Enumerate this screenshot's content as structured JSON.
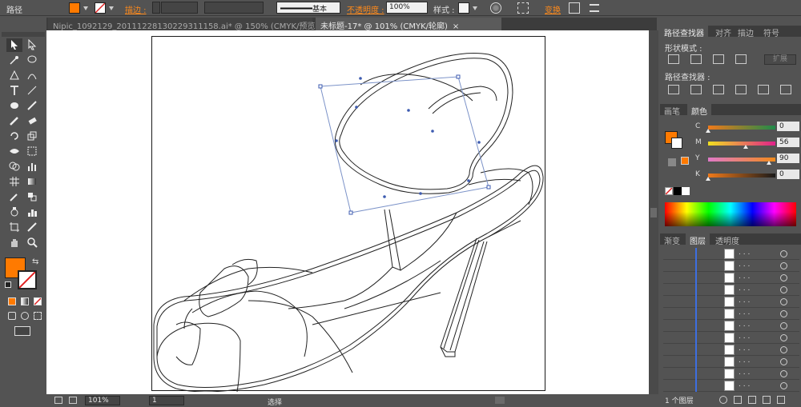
{
  "control_bar": {
    "object_type": "路径",
    "fill_color": "#ff7a00",
    "stroke_label": "描边 :",
    "stroke_profile_label": "基本",
    "opacity_label": "不透明度 :",
    "opacity_value": "100%",
    "style_label": "样式 :",
    "transform_label": "变换"
  },
  "tabs": [
    {
      "label": "Nipic_1092129_20111228130229311158.ai* @ 150% (CMYK/预览)",
      "close": "×"
    },
    {
      "label": "未标题-17* @ 101% (CMYK/轮廓)",
      "close": "×"
    }
  ],
  "tools": {
    "fill_color": "#ff7a00",
    "stroke_color": "#ffffff"
  },
  "status_bar": {
    "zoom": "101%",
    "page": "1",
    "mode": "选择"
  },
  "pathfinder_panel": {
    "tabs": [
      "路径查找器",
      "对齐",
      "描边",
      "符号"
    ],
    "shape_modes_label": "形状模式 :",
    "expand_label": "扩展",
    "pathfinders_label": "路径查找器 :"
  },
  "color_panel": {
    "tabs": [
      "画笔",
      "颜色"
    ],
    "channels": [
      {
        "name": "C",
        "value": "0",
        "knob": 0.0,
        "gradient": "linear-gradient(to right,#f07a1a,#1f8a4a)"
      },
      {
        "name": "M",
        "value": "56",
        "knob": 0.56,
        "gradient": "linear-gradient(to right,#f0e020,#e0208a)"
      },
      {
        "name": "Y",
        "value": "90",
        "knob": 0.9,
        "gradient": "linear-gradient(to right,#e07ac8,#f08a1a)"
      },
      {
        "name": "K",
        "value": "0",
        "knob": 0.0,
        "gradient": "linear-gradient(to right,#f07a1a,#1a1a1a)"
      }
    ]
  },
  "layers_panel": {
    "tabs": [
      "渐变",
      "图层",
      "透明度"
    ],
    "layer_count": "1 个图层",
    "rows": [
      {
        "name": ". . ."
      },
      {
        "name": ". . ."
      },
      {
        "name": ". . ."
      },
      {
        "name": ". . ."
      },
      {
        "name": ". . ."
      },
      {
        "name": ". . ."
      },
      {
        "name": ". . ."
      },
      {
        "name": ". . ."
      },
      {
        "name": ". . ."
      },
      {
        "name": ". . ."
      },
      {
        "name": ". . ."
      },
      {
        "name": ". . ."
      }
    ]
  }
}
